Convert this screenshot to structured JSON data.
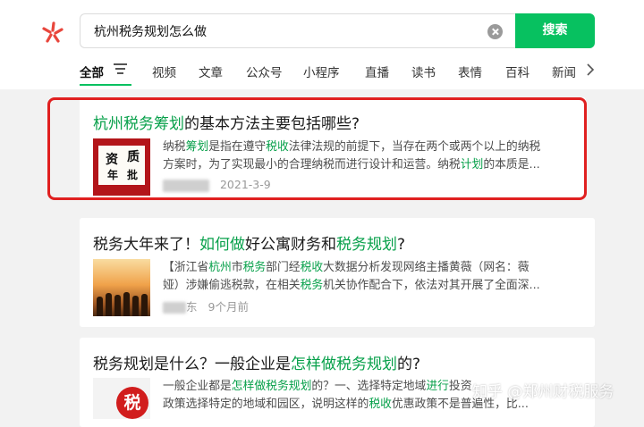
{
  "search": {
    "query": "杭州税务规划怎么做",
    "button_label": "搜索"
  },
  "tabs": [
    "全部",
    "视频",
    "文章",
    "公众号",
    "小程序",
    "直播",
    "读书",
    "表情",
    "百科",
    "新闻"
  ],
  "colors": {
    "accent": "#07c160",
    "highlight_text": "#07a04a",
    "annotation_box": "#e02020"
  },
  "results": [
    {
      "title_parts": [
        "杭州税务筹划",
        "的基本方法主要包括哪些?"
      ],
      "snippet_line1_parts": [
        "纳税",
        "筹划",
        "是指在遵守",
        "税收",
        "法律法规的前提下，当存在两个或两个以上的纳税"
      ],
      "snippet_line2_parts": [
        "方案时，为了实现最小的合理纳税而进行设计和运营。纳税",
        "计划",
        "的本质是..."
      ],
      "thumb_text": [
        "资",
        "质",
        "年",
        "批"
      ],
      "date": "2021-3-9"
    },
    {
      "title_parts": [
        "税务大年来了！",
        "如何做",
        "好公寓财务和",
        "税务规划",
        "?"
      ],
      "snippet_line1_parts": [
        "【浙江省",
        "杭州",
        "市",
        "税务",
        "部门经",
        "税收",
        "大数据分析发现网络主播黄薇（网名：薇"
      ],
      "snippet_line2_parts": [
        "娅）涉嫌偷逃税款，在相关",
        "税务",
        "机关协作配合下，依法对其开展了全面深..."
      ],
      "meta_source": "东",
      "meta_time": "9个月前"
    },
    {
      "title_parts": [
        "税务规划是什么？一般企业是",
        "怎样做税务规划",
        "的?"
      ],
      "snippet_line1_parts": [
        "一般企业都是",
        "怎样做税务规划",
        "的？一、选择特定地域",
        "进行",
        "投资"
      ],
      "snippet_line2_parts": [
        "政策选择特定的地域和园区，说明这样的",
        "税收",
        "优惠政策不是普遍性，比..."
      ],
      "thumb_text": "税"
    }
  ],
  "watermark": "知乎 @郑州财税服务"
}
